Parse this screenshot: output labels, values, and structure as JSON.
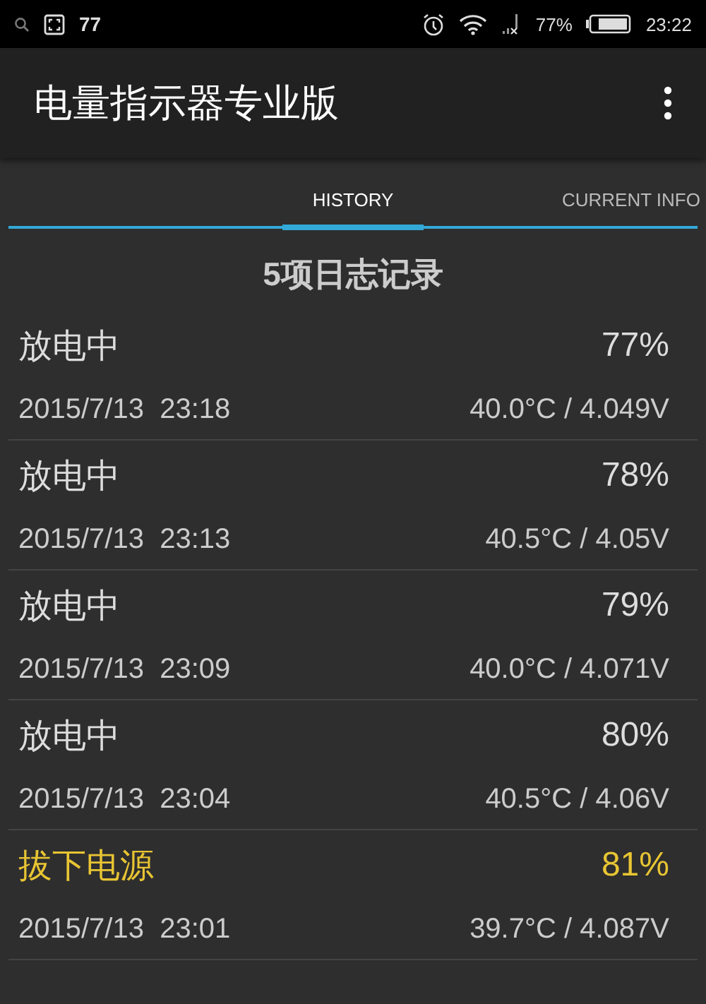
{
  "status_bar": {
    "notification_count": "77",
    "battery": "77%",
    "time": "23:22"
  },
  "app_bar": {
    "title": "电量指示器专业版"
  },
  "tabs": [
    {
      "label": "HISTORY",
      "selected": true
    },
    {
      "label": "CURRENT INFO",
      "selected": false
    }
  ],
  "history": {
    "heading": "5项日志记录",
    "entries": [
      {
        "kind": "discharging",
        "event": "放电中",
        "percent": "77%",
        "time": "2015/7/13  23:18",
        "reading": "40.0°C / 4.049V"
      },
      {
        "kind": "discharging",
        "event": "放电中",
        "percent": "78%",
        "time": "2015/7/13  23:13",
        "reading": "40.5°C / 4.05V"
      },
      {
        "kind": "discharging",
        "event": "放电中",
        "percent": "79%",
        "time": "2015/7/13  23:09",
        "reading": "40.0°C / 4.071V"
      },
      {
        "kind": "discharging",
        "event": "放电中",
        "percent": "80%",
        "time": "2015/7/13  23:04",
        "reading": "40.5°C / 4.06V"
      },
      {
        "kind": "unplugged",
        "event": "拔下电源",
        "percent": "81%",
        "time": "2015/7/13  23:01",
        "reading": "39.7°C / 4.087V"
      }
    ]
  }
}
